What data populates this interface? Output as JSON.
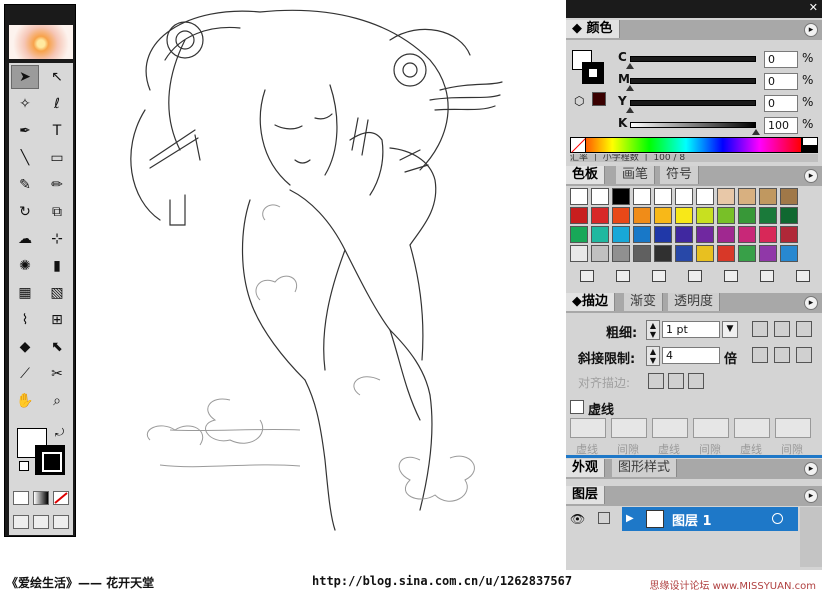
{
  "toolbox": {
    "tools": [
      {
        "name": "selection-tool",
        "glyph": "➤"
      },
      {
        "name": "direct-selection-tool",
        "glyph": "↖"
      },
      {
        "name": "magic-wand-tool",
        "glyph": "✧"
      },
      {
        "name": "lasso-tool",
        "glyph": "ℓ"
      },
      {
        "name": "pen-tool",
        "glyph": "✒"
      },
      {
        "name": "type-tool",
        "glyph": "T"
      },
      {
        "name": "line-tool",
        "glyph": "╲"
      },
      {
        "name": "rectangle-tool",
        "glyph": "▭"
      },
      {
        "name": "paintbrush-tool",
        "glyph": "✎"
      },
      {
        "name": "pencil-tool",
        "glyph": "✏"
      },
      {
        "name": "rotate-tool",
        "glyph": "↻"
      },
      {
        "name": "scale-tool",
        "glyph": "⧉"
      },
      {
        "name": "warp-tool",
        "glyph": "☁"
      },
      {
        "name": "free-transform-tool",
        "glyph": "⊹"
      },
      {
        "name": "symbol-sprayer-tool",
        "glyph": "✺"
      },
      {
        "name": "column-graph-tool",
        "glyph": "▮"
      },
      {
        "name": "mesh-tool",
        "glyph": "▦"
      },
      {
        "name": "gradient-tool",
        "glyph": "▧"
      },
      {
        "name": "eyedropper-tool",
        "glyph": "⌇"
      },
      {
        "name": "blend-tool",
        "glyph": "⊞"
      },
      {
        "name": "live-paint-bucket-tool",
        "glyph": "◆"
      },
      {
        "name": "live-paint-selection-tool",
        "glyph": "⬉"
      },
      {
        "name": "slice-tool",
        "glyph": "⟋"
      },
      {
        "name": "scissors-tool",
        "glyph": "✂"
      },
      {
        "name": "hand-tool",
        "glyph": "✋"
      },
      {
        "name": "zoom-tool",
        "glyph": "⌕"
      }
    ]
  },
  "color_panel": {
    "title": "颜色",
    "channels": [
      {
        "label": "C",
        "value": "0",
        "unit": "%",
        "level": 0
      },
      {
        "label": "M",
        "value": "0",
        "unit": "%",
        "level": 0
      },
      {
        "label": "Y",
        "value": "0",
        "unit": "%",
        "level": 0
      },
      {
        "label": "K",
        "value": "100",
        "unit": "%",
        "level": 1
      }
    ],
    "cut_row": "汇率 丨 小学程数 丨 100 / 8"
  },
  "swatches_panel": {
    "tabs": [
      "色板",
      "画笔",
      "符号"
    ],
    "colors": [
      "#ffffff",
      "#ffffff",
      "#000000",
      "#ffffff",
      "#ffffff",
      "#ffffff",
      "#ffffff",
      "#e8c8a8",
      "#d8b080",
      "#c09860",
      "#a07848",
      "#c81e1e",
      "#d82828",
      "#e84818",
      "#f08c18",
      "#f8b818",
      "#f8e818",
      "#c8e020",
      "#78c028",
      "#389838",
      "#1a7a3a",
      "#106830",
      "#18a858",
      "#20b8a0",
      "#18a8d8",
      "#1878c8",
      "#2038a8",
      "#4028a0",
      "#7028a0",
      "#a02890",
      "#c82878",
      "#d82858",
      "#b02838",
      "#e8e8e8",
      "#c0c0c0",
      "#909090",
      "#606060",
      "#303030",
      "#2848a8",
      "#e8c020",
      "#d83828",
      "#38a048",
      "#9038a8",
      "#2888d0"
    ]
  },
  "stroke_panel": {
    "tabs": [
      "描边",
      "渐变",
      "透明度"
    ],
    "weight_label": "粗细:",
    "weight_value": "1 pt",
    "miter_label": "斜接限制:",
    "miter_value": "4",
    "miter_unit": "倍",
    "align_label": "对齐描边:",
    "dashed_label": "虚线",
    "dash_labels": [
      "虚线",
      "间隙",
      "虚线",
      "间隙",
      "虚线",
      "间隙"
    ]
  },
  "appearance_panel": {
    "tabs": [
      "外观",
      "图形样式"
    ]
  },
  "layers_panel": {
    "title": "图层",
    "layers": [
      {
        "name": "图层 1"
      }
    ]
  },
  "caption": {
    "title": "《爱绘生活》—— 花开天堂",
    "url": "http://blog.sina.com.cn/u/1262837567",
    "watermark": "思缘设计论坛 www.MISSYUAN.com"
  },
  "colors": {
    "accent": "#1e78c8",
    "panel_bg": "#d4d4d4",
    "titlebar": "#1b1b1b"
  }
}
